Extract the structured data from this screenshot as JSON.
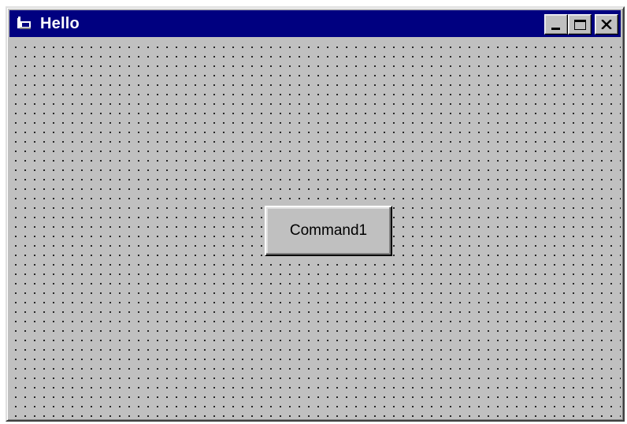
{
  "window": {
    "title": "Hello",
    "icon": "form-icon",
    "controls": {
      "minimize_icon": "minimize-icon",
      "maximize_icon": "maximize-icon",
      "close_label": "✕",
      "close_icon": "close-icon"
    }
  },
  "form": {
    "grid": "dotted",
    "background_color": "#c0c0c0",
    "command_button": {
      "label": "Command1"
    }
  },
  "colors": {
    "titlebar": "#000080",
    "title_text": "#ffffff",
    "face": "#c0c0c0"
  }
}
